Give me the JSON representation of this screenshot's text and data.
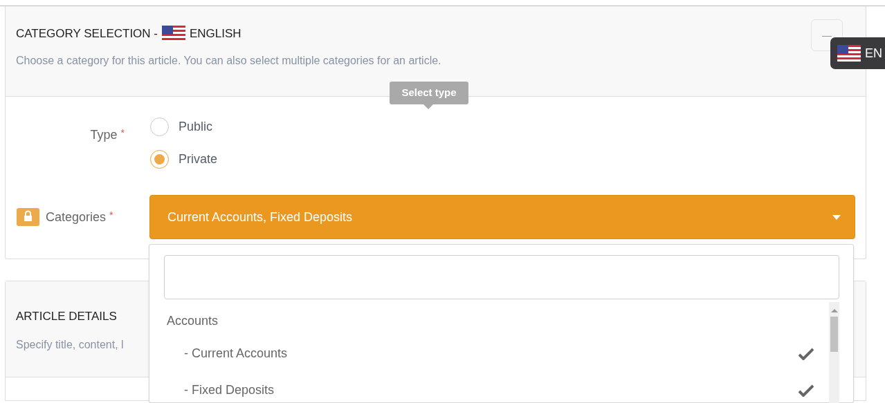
{
  "category_panel": {
    "title": "CATEGORY SELECTION -",
    "language": "ENGLISH",
    "description": "Choose a category for this article. You can also select multiple categories for an article.",
    "collapse_symbol": "—"
  },
  "tooltip": "Select type",
  "language_badge": "EN",
  "type_field": {
    "label": "Type",
    "required_mark": "*",
    "options": [
      {
        "label": "Public",
        "selected": false
      },
      {
        "label": "Private",
        "selected": true
      }
    ]
  },
  "categories_field": {
    "label": "Categories",
    "required_mark": "*",
    "value": "Current Accounts, Fixed Deposits",
    "open": true
  },
  "dropdown": {
    "items": [
      {
        "kind": "group",
        "label": "Accounts"
      },
      {
        "kind": "option",
        "label": "- Current Accounts",
        "checked": true
      },
      {
        "kind": "option",
        "label": "- Fixed Deposits",
        "checked": true
      }
    ]
  },
  "article_panel": {
    "title": "ARTICLE DETAILS",
    "description": "Specify title, content, l"
  }
}
